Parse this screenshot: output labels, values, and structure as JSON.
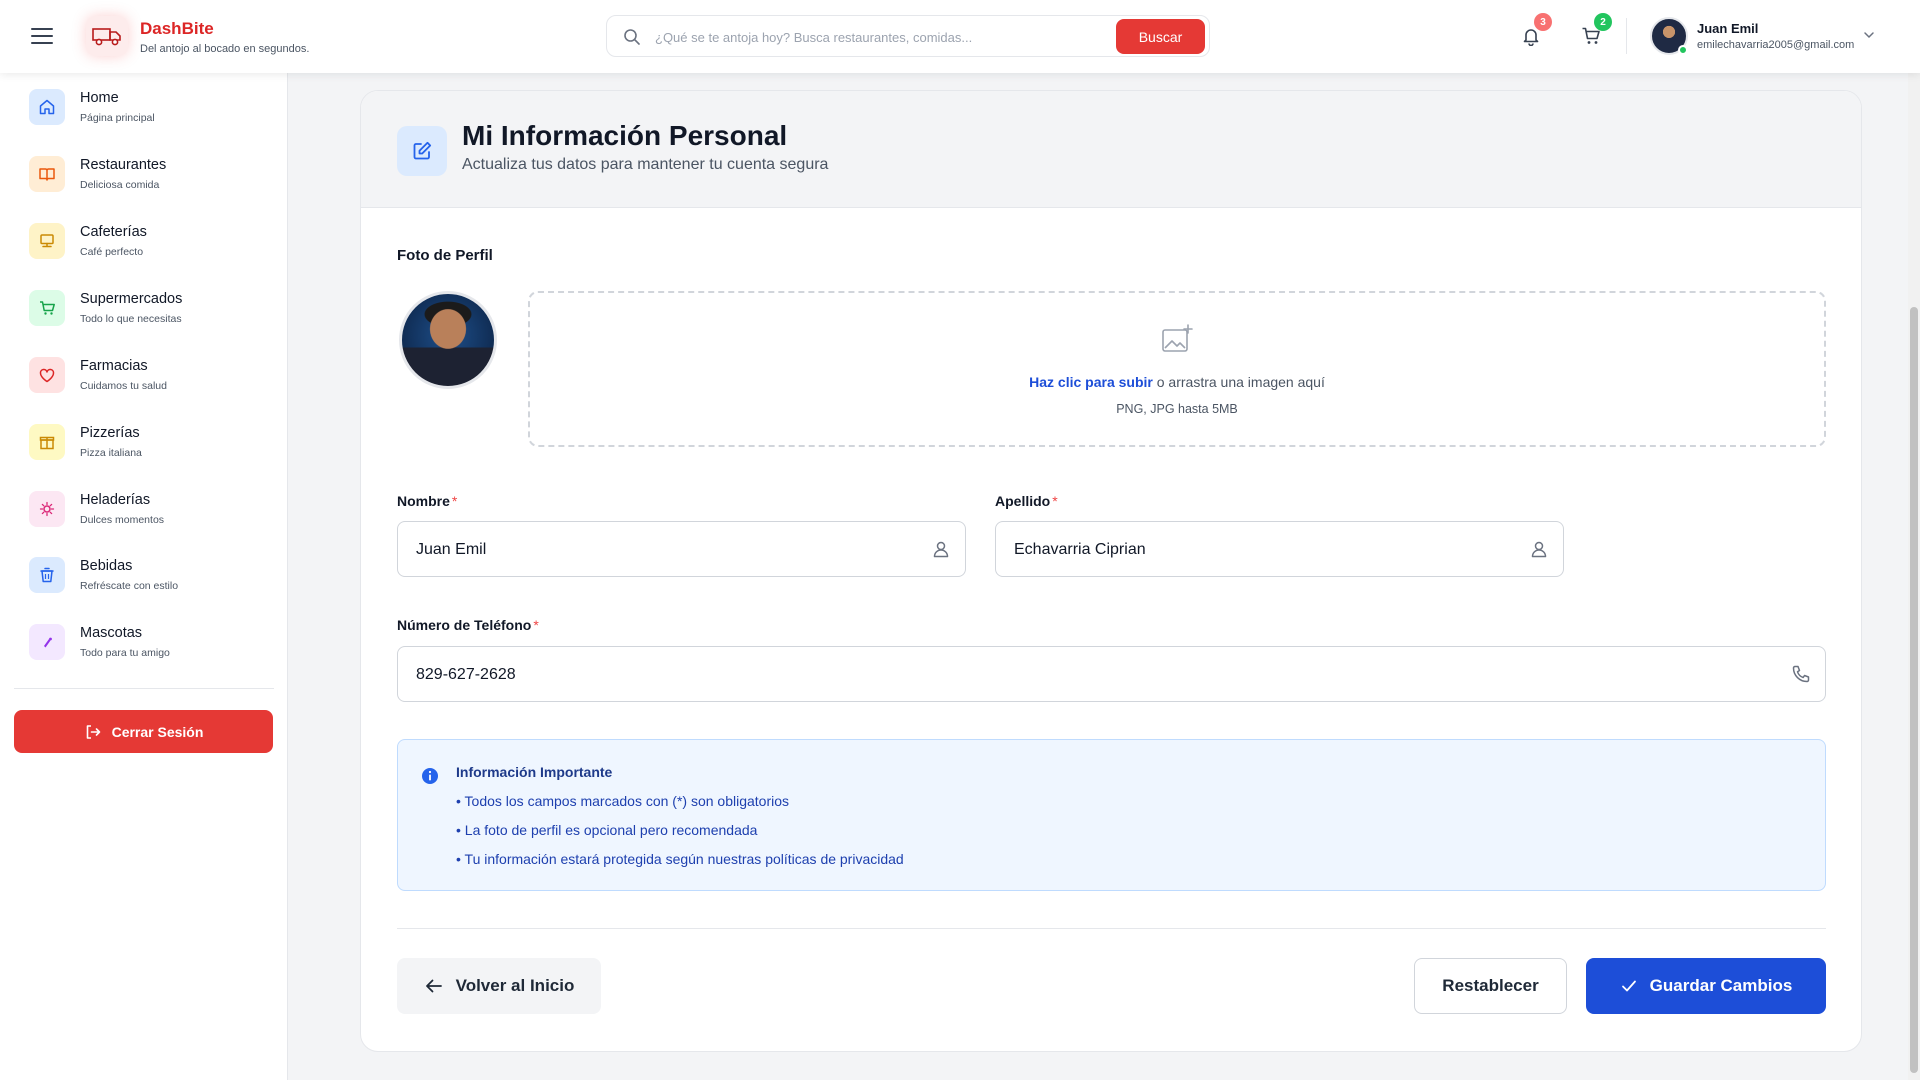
{
  "header": {
    "brand_name": "DashBite",
    "brand_tagline": "Del antojo al bocado en segundos.",
    "search": {
      "placeholder": "¿Qué se te antoja hoy? Busca restaurantes, comidas...",
      "value": "",
      "button_label": "Buscar"
    },
    "notifications": {
      "icon": "bell-icon",
      "count": "3"
    },
    "cart": {
      "icon": "cart-icon",
      "count": "2"
    },
    "user": {
      "name": "Juan Emil",
      "email": "emilechavarria2005@gmail.com",
      "status_color": "#22c55e"
    }
  },
  "sidebar": {
    "items": [
      {
        "label": "Home",
        "sub": "Página principal",
        "icon": "home-icon",
        "color": "#dbeafe",
        "accent": "#2563eb"
      },
      {
        "label": "Restaurantes",
        "sub": "Deliciosa comida",
        "icon": "book-icon",
        "color": "#ffedd5",
        "accent": "#ea580c"
      },
      {
        "label": "Cafeterías",
        "sub": "Café perfecto",
        "icon": "monitor-icon",
        "color": "#fef3c7",
        "accent": "#ca8a04"
      },
      {
        "label": "Supermercados",
        "sub": "Todo lo que necesitas",
        "icon": "cart-icon",
        "color": "#dcfce7",
        "accent": "#16a34a"
      },
      {
        "label": "Farmacias",
        "sub": "Cuidamos tu salud",
        "icon": "heart-icon",
        "color": "#fee2e2",
        "accent": "#dc2626"
      },
      {
        "label": "Pizzerías",
        "sub": "Pizza italiana",
        "icon": "gift-icon",
        "color": "#fef9c3",
        "accent": "#ca8a04"
      },
      {
        "label": "Heladerías",
        "sub": "Dulces momentos",
        "icon": "sparkle-icon",
        "color": "#fce7f3",
        "accent": "#db2777"
      },
      {
        "label": "Bebidas",
        "sub": "Refréscate con estilo",
        "icon": "cup-icon",
        "color": "#dbeafe",
        "accent": "#2563eb"
      },
      {
        "label": "Mascotas",
        "sub": "Todo para tu amigo",
        "icon": "paw-icon",
        "color": "#f3e8ff",
        "accent": "#9333ea"
      }
    ],
    "logout_label": "Cerrar Sesión"
  },
  "profile": {
    "title": "Mi Información Personal",
    "subtitle": "Actualiza tus datos para mantener tu cuenta segura",
    "photo": {
      "label": "Foto de Perfil",
      "upload_link": "Haz clic para subir",
      "upload_rest": " o arrastra una imagen aquí",
      "hint": "PNG, JPG hasta 5MB"
    },
    "fields": {
      "first_name": {
        "label": "Nombre",
        "value": "Juan Emil"
      },
      "last_name": {
        "label": "Apellido",
        "value": "Echavarria Ciprian"
      },
      "phone": {
        "label": "Número de Teléfono",
        "value": "829-627-2628"
      },
      "required_mark": "*"
    },
    "info": {
      "title": "Información Importante",
      "lines": [
        "• Todos los campos marcados con (*) son obligatorios",
        "• La foto de perfil es opcional pero recomendada",
        "• Tu información estará protegida según nuestras políticas de privacidad"
      ]
    },
    "buttons": {
      "back": "Volver al Inicio",
      "reset": "Restablecer",
      "save": "Guardar Cambios"
    }
  },
  "colors": {
    "brand": "#dc2626",
    "primary": "#1d4ed8",
    "danger": "#e53935"
  }
}
